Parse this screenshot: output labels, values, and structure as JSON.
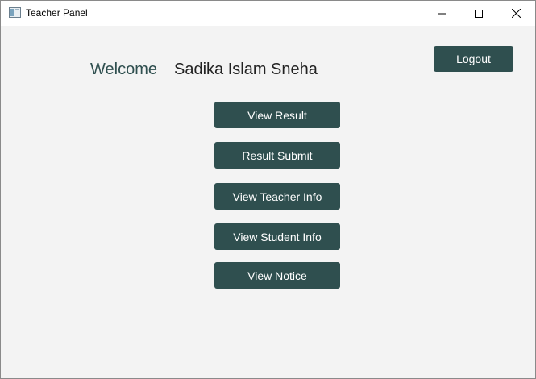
{
  "window": {
    "title": "Teacher Panel",
    "icons": {
      "app": "app-window-icon",
      "minimize": "minimize-icon",
      "maximize": "maximize-icon",
      "close": "close-icon"
    }
  },
  "header": {
    "welcome_label": "Welcome",
    "user_name": "Sadika Islam Sneha",
    "logout_label": "Logout"
  },
  "menu": {
    "buttons": [
      {
        "label": "View Result"
      },
      {
        "label": "Result Submit"
      },
      {
        "label": "View Teacher Info"
      },
      {
        "label": "View Student Info"
      },
      {
        "label": "View Notice"
      }
    ]
  },
  "colors": {
    "button_background": "#2f4f4f",
    "button_text": "#ffffff",
    "welcome_text": "#2f4f4f",
    "content_background": "#f3f3f3"
  }
}
